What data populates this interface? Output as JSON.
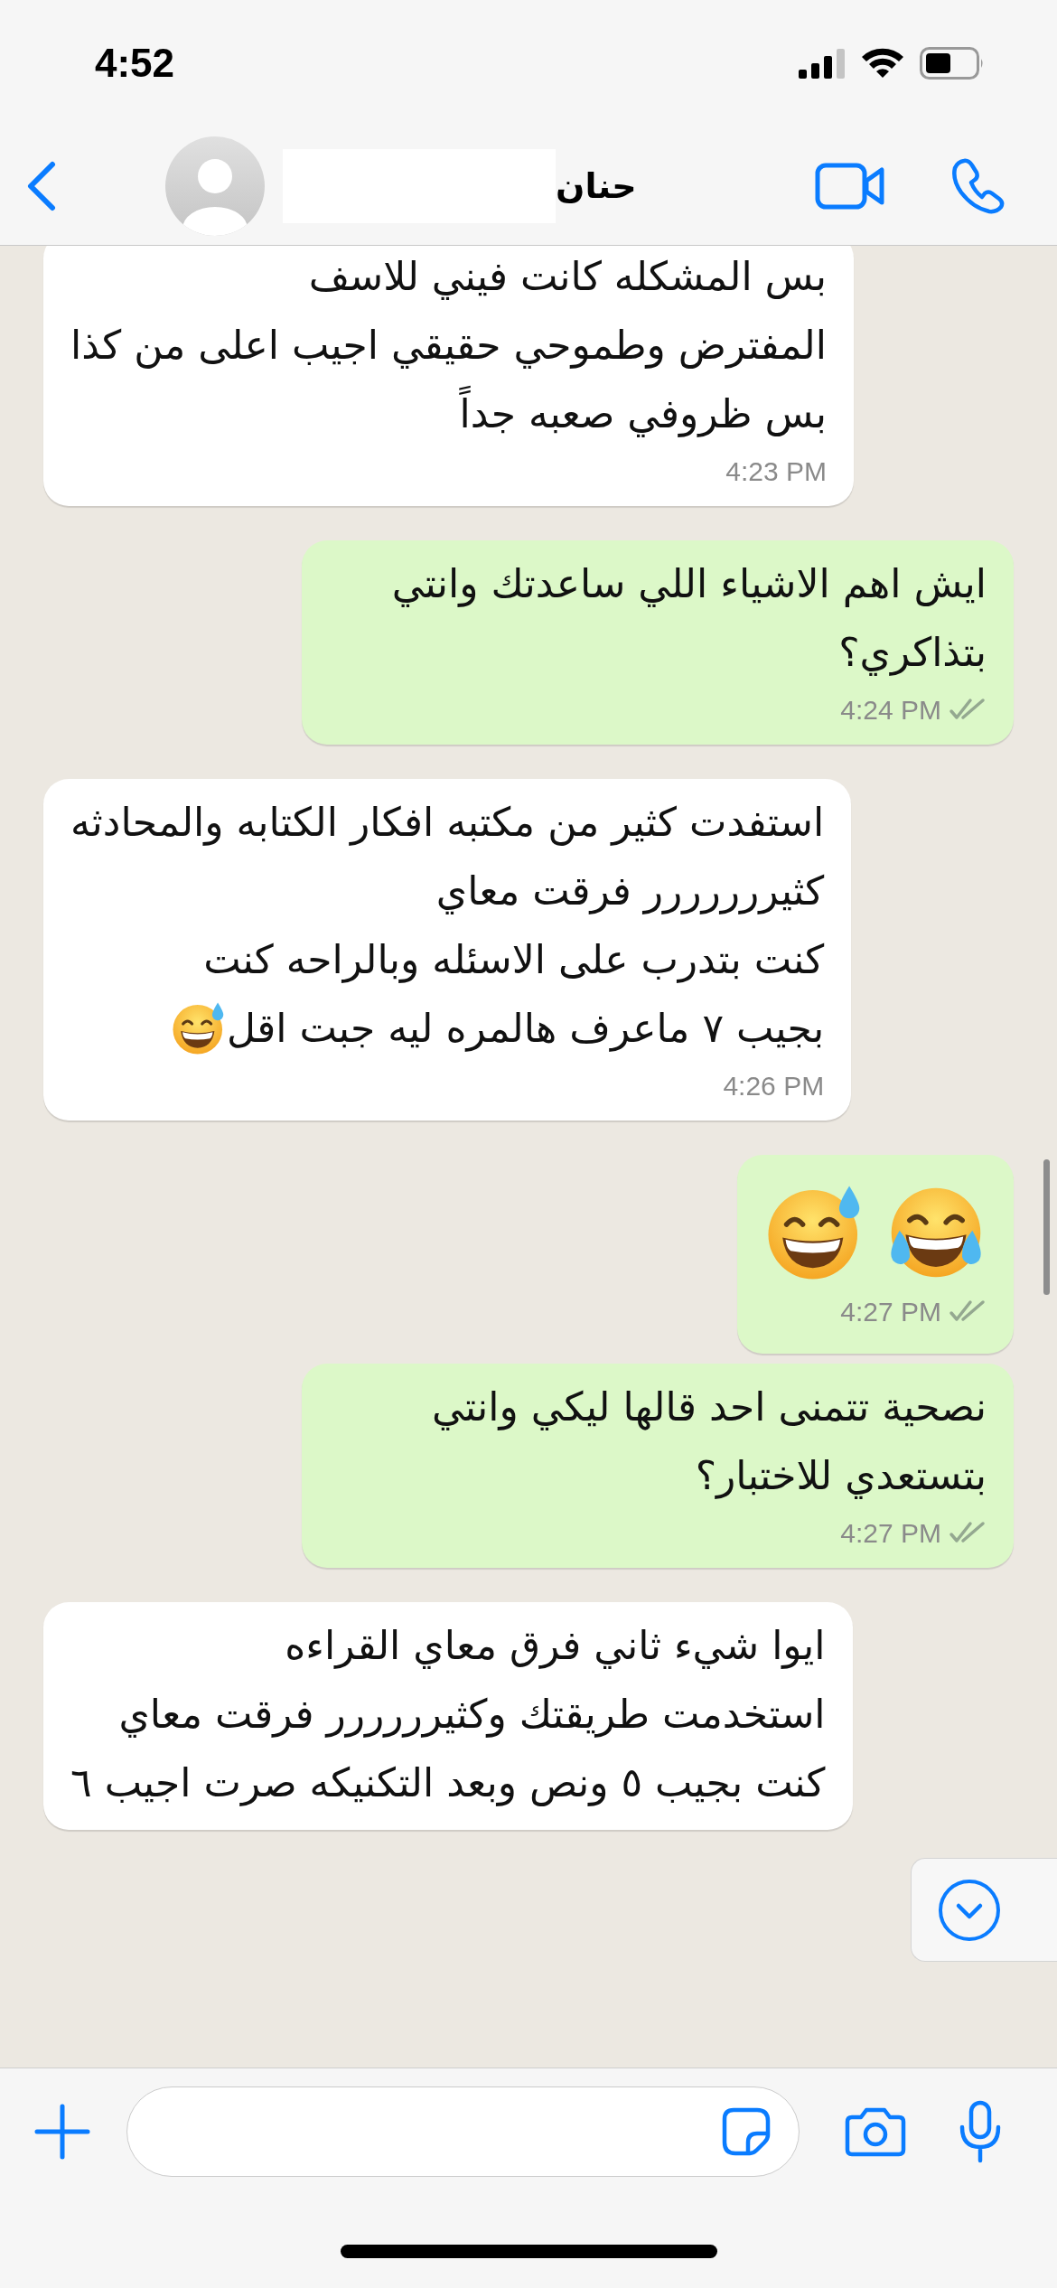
{
  "status_bar": {
    "time": "4:52"
  },
  "header": {
    "contact_name": "حنان",
    "name_redacted": true
  },
  "messages": [
    {
      "outgoing": false,
      "kind": "text",
      "paragraphs": [
        "بس المشكله كانت فيني للاسف",
        "المفترض وطموحي حقيقي اجيب اعلى من كذا",
        "بس ظروفي صعبه جداً"
      ],
      "time": "4:23 PM"
    },
    {
      "outgoing": true,
      "kind": "text",
      "paragraphs": [
        "ايش اهم الاشياء اللي ساعدتك وانتي بتذاكري؟"
      ],
      "time": "4:24 PM",
      "read": false
    },
    {
      "outgoing": false,
      "kind": "text",
      "paragraphs": [
        "استفدت كثير من مكتبه افكار الكتابه والمحادثه",
        "كثيررررررر فرقت معاي",
        "كنت بتدرب على الاسئله وبالراحه كنت",
        "بجيب ٧ ماعرف هالمره ليه جبت اقل"
      ],
      "trailing_emoji": true,
      "time": "4:26 PM"
    },
    {
      "outgoing": true,
      "kind": "emoji",
      "time": "4:27 PM",
      "read": false
    },
    {
      "outgoing": true,
      "kind": "text",
      "paragraphs": [
        "نصحية تتمنى احد قالها ليكي وانتي بتستعدي للاختبار؟"
      ],
      "time": "4:27 PM",
      "read": false
    },
    {
      "outgoing": false,
      "kind": "text",
      "paragraphs": [
        "ايوا شيء ثاني فرق معاي القراءه",
        "استخدمت طريقتك وكثيرررررر فرقت معاي",
        "كنت بجيب ٥ ونص وبعد التكنيكه صرت اجيب ٦"
      ]
    }
  ]
}
